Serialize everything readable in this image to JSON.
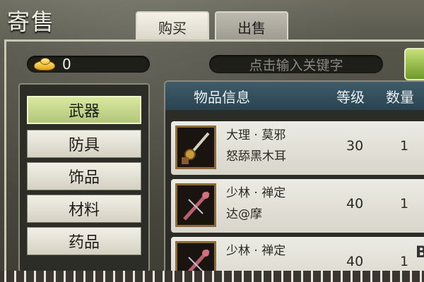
{
  "window": {
    "title": "寄售"
  },
  "tabs": [
    {
      "label": "购买",
      "active": true
    },
    {
      "label": "出售",
      "active": false
    }
  ],
  "currency": {
    "icon": "gold-ingot-icon",
    "amount": "0"
  },
  "search": {
    "placeholder": "点击输入关键字"
  },
  "categories": [
    {
      "label": "武器",
      "active": true
    },
    {
      "label": "防具",
      "active": false
    },
    {
      "label": "饰品",
      "active": false
    },
    {
      "label": "材料",
      "active": false
    },
    {
      "label": "药品",
      "active": false
    }
  ],
  "list": {
    "headers": {
      "info": "物品信息",
      "level": "等级",
      "quantity": "数量"
    },
    "rows": [
      {
        "name_line1": "大理 · 莫邪",
        "name_line2": "怒舔黑木耳",
        "level": "30",
        "quantity": "1",
        "icon": "sword-icon"
      },
      {
        "name_line1": "少林 · 禅定",
        "name_line2": "达@摩",
        "level": "40",
        "quantity": "1",
        "icon": "staff-icon"
      },
      {
        "name_line1": "少林 · 禅定",
        "name_line2": "",
        "level": "40",
        "quantity": "1",
        "icon": "staff-icon",
        "badge": "B"
      }
    ]
  },
  "colors": {
    "panel_bg": "#4a4a40",
    "active_category": "#c8d78f",
    "header_bg": "#35505c",
    "gold": "#f0c030"
  }
}
